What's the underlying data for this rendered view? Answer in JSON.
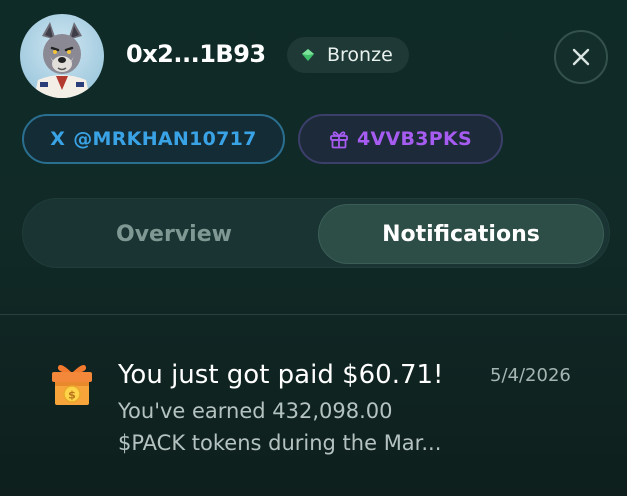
{
  "profile": {
    "wallet_address": "0x2...1B93",
    "tier": {
      "label": "Bronze",
      "gem_color": "#3fbf6a",
      "icon": "gem-icon"
    },
    "close_icon": "close-icon"
  },
  "socials": {
    "twitter": {
      "icon": "x-logo-icon",
      "glyph": "X",
      "handle": "@MRKHAN10717",
      "color": "#3aa3e6"
    },
    "referral": {
      "icon": "gift-icon",
      "code": "4VVB3PKS",
      "color": "#a65cf0"
    }
  },
  "tabs": [
    {
      "label": "Overview",
      "active": false
    },
    {
      "label": "Notifications",
      "active": true
    }
  ],
  "notifications": [
    {
      "icon": "gift-box-coin-icon",
      "title": "You just got paid $60.71!",
      "date": "5/4/2026",
      "body": "You've earned 432,098.00 $PACK tokens during the Mar..."
    }
  ],
  "colors": {
    "accent_green": "#2d4d47",
    "background": "#0f2b27"
  }
}
